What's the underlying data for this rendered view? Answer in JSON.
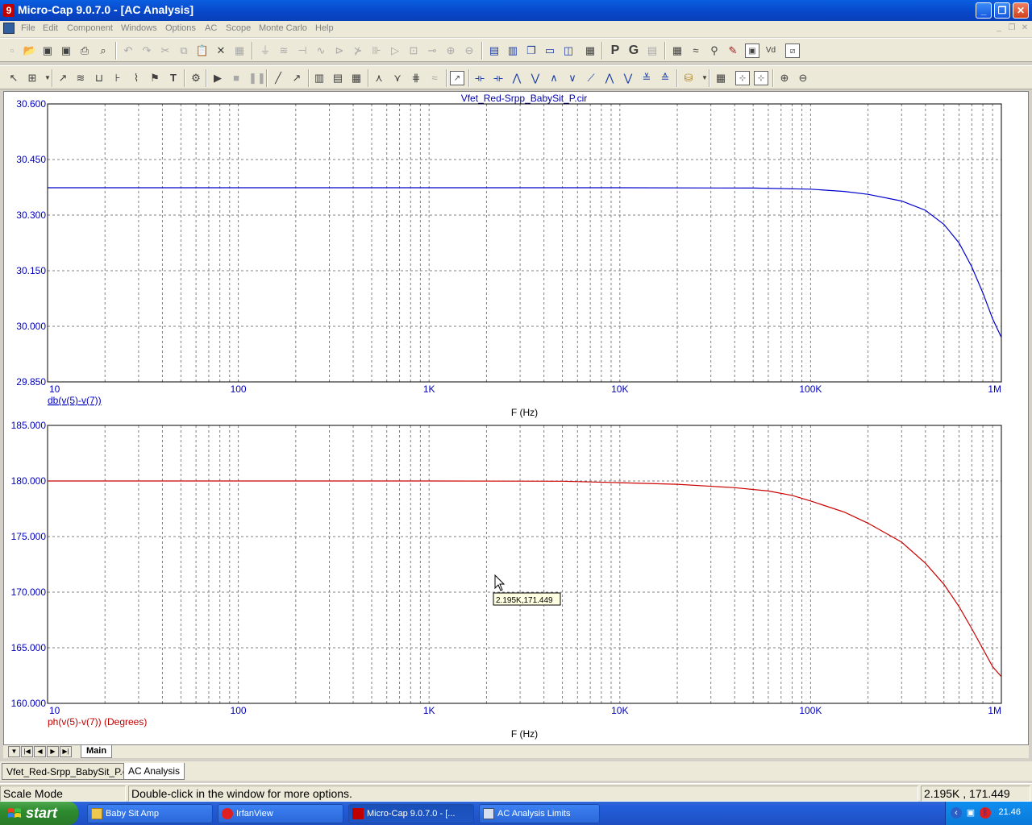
{
  "window": {
    "title": "Micro-Cap 9.0.7.0 - [AC Analysis]",
    "app_icon_label": "9"
  },
  "menu": {
    "items": [
      "File",
      "Edit",
      "Component",
      "Windows",
      "Options",
      "AC",
      "Scope",
      "Monte Carlo",
      "Help"
    ]
  },
  "toolbar_text": {
    "p_label": "P",
    "g_label": "G"
  },
  "plot": {
    "title": "Vfet_Red-Srpp_BabySit_P.cir",
    "cursor_tooltip": "2.195K,171.449"
  },
  "chart_data": [
    {
      "type": "line",
      "title": "Vfet_Red-Srpp_BabySit_P.cir",
      "xlabel": "F (Hz)",
      "ylabel": "db(v(5)-v(7))",
      "x_scale": "log",
      "xlim": [
        10,
        1000000
      ],
      "ylim": [
        29.85,
        30.6
      ],
      "x_tick_labels": [
        "10",
        "100",
        "1K",
        "10K",
        "100K",
        "1M"
      ],
      "y_tick_labels": [
        "30.600",
        "30.450",
        "30.300",
        "30.150",
        "30.000",
        "29.850"
      ],
      "grid": true,
      "series": [
        {
          "name": "db(v(5)-v(7))",
          "color": "#0000cc",
          "x": [
            10,
            100,
            1000,
            10000,
            50000,
            100000,
            150000,
            200000,
            300000,
            400000,
            500000,
            600000,
            700000,
            800000,
            900000,
            1000000
          ],
          "y": [
            30.374,
            30.374,
            30.374,
            30.374,
            30.373,
            30.37,
            30.364,
            30.356,
            30.338,
            30.313,
            30.275,
            30.225,
            30.16,
            30.09,
            30.02,
            29.97
          ]
        }
      ]
    },
    {
      "type": "line",
      "xlabel": "F (Hz)",
      "ylabel": "ph(v(5)-v(7)) (Degrees)",
      "x_scale": "log",
      "xlim": [
        10,
        1000000
      ],
      "ylim": [
        160,
        185
      ],
      "x_tick_labels": [
        "10",
        "100",
        "1K",
        "10K",
        "100K",
        "1M"
      ],
      "y_tick_labels": [
        "185.000",
        "180.000",
        "175.000",
        "170.000",
        "165.000",
        "160.000"
      ],
      "grid": true,
      "series": [
        {
          "name": "ph(v(5)-v(7)) (Degrees)",
          "color": "#cc0000",
          "x": [
            10,
            100,
            1000,
            5000,
            10000,
            20000,
            40000,
            60000,
            80000,
            100000,
            150000,
            200000,
            300000,
            400000,
            500000,
            600000,
            700000,
            800000,
            900000,
            1000000
          ],
          "y": [
            180,
            180,
            180,
            179.98,
            179.85,
            179.7,
            179.4,
            179.1,
            178.7,
            178.2,
            177.2,
            176.2,
            174.5,
            172.6,
            170.7,
            168.7,
            166.7,
            164.9,
            163.3,
            162.4
          ]
        }
      ]
    }
  ],
  "tabs": {
    "page_tab": "Main",
    "doc_tab_1": "Vfet_Red-Srpp_BabySit_P.cir",
    "doc_tab_2": "AC Analysis"
  },
  "status": {
    "mode": "Scale Mode",
    "hint": "Double-click in the window for more options.",
    "coords": "2.195K , 171.449"
  },
  "taskbar": {
    "start": "start",
    "items": [
      "Baby Sit Amp",
      "IrfanView",
      "Micro-Cap 9.0.7.0 - [...",
      "AC Analysis Limits"
    ],
    "time": "21.46"
  }
}
